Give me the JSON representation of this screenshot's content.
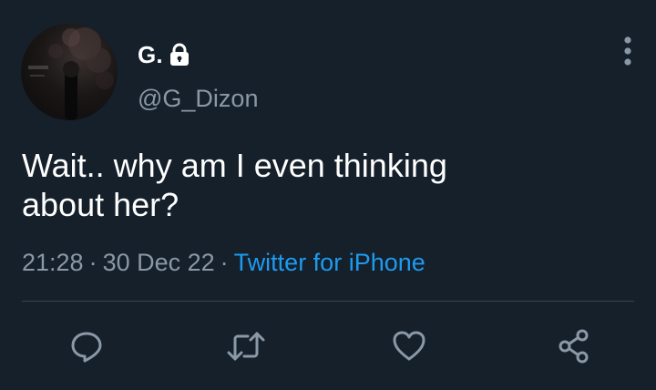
{
  "tweet": {
    "author": {
      "display_name": "G.",
      "handle": "@G_Dizon",
      "protected_icon": "lock-icon",
      "avatar": "avatar"
    },
    "text_line1": "Wait.. why am I even thinking",
    "text_line2": "about her?",
    "time": "21:28",
    "date": "30 Dec 22",
    "separator": "·",
    "source": "Twitter for iPhone"
  },
  "actions": [
    {
      "icon": "reply-icon"
    },
    {
      "icon": "retweet-icon"
    },
    {
      "icon": "like-icon"
    },
    {
      "icon": "share-icon"
    }
  ],
  "menu_icon": "more-options-icon",
  "colors": {
    "background": "#15202b",
    "text_primary": "#ffffff",
    "text_secondary": "#8b98a5",
    "accent": "#1d9bf0",
    "divider": "#38444d"
  }
}
